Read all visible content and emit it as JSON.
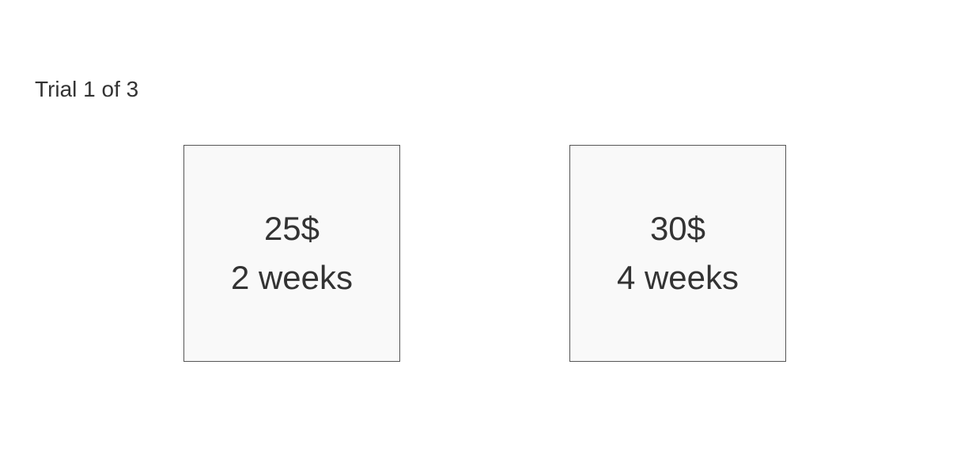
{
  "trial": {
    "label": "Trial 1 of 3"
  },
  "options": [
    {
      "amount": "25$",
      "delay": "2 weeks"
    },
    {
      "amount": "30$",
      "delay": "4 weeks"
    }
  ],
  "colors": {
    "text": "#333333",
    "box_background": "#f9f9f9",
    "box_border": "#555555",
    "page_background": "#ffffff"
  }
}
